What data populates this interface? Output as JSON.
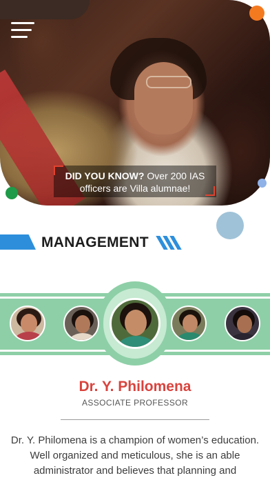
{
  "hero": {
    "did_you_know": "DID YOU KNOW?",
    "fact": " Over 200 IAS officers are Villa alumnae!"
  },
  "section": {
    "heading": "MANAGEMENT"
  },
  "carousel": {
    "selected_index": 2,
    "item_count": 5
  },
  "profile": {
    "name": "Dr. Y. Philomena",
    "role": "ASSOCIATE PROFESSOR",
    "bio": "Dr. Y. Philomena is a champion of women’s education. Well organized and meticulous, she is an able administrator and believes that planning and"
  },
  "colors": {
    "accent_blue": "#2d8fdc",
    "name_red": "#d9433d",
    "band_green": "#8ecfa7",
    "dot_orange": "#f47a20",
    "dot_green": "#1e9a48"
  },
  "icons": {
    "menu": "hamburger-menu-icon"
  }
}
